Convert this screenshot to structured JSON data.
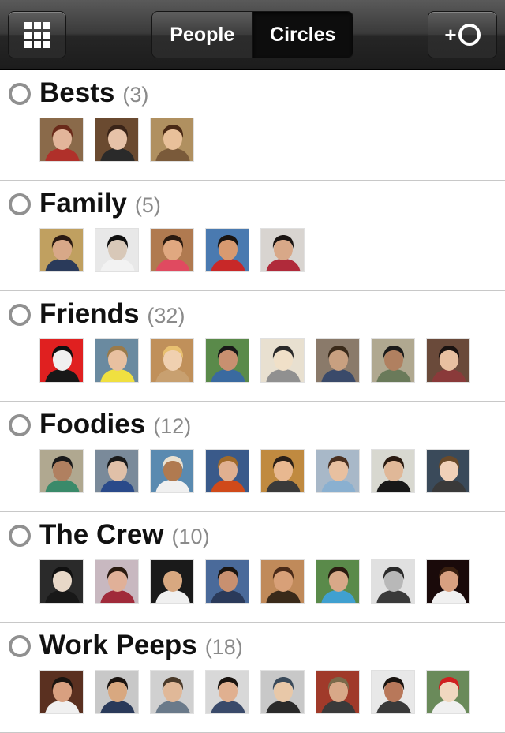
{
  "header": {
    "grid_icon": "grid-icon",
    "tabs": [
      {
        "label": "People",
        "selected": false
      },
      {
        "label": "Circles",
        "selected": true
      }
    ],
    "add_circle": {
      "plus": "+",
      "icon": "circle-ring-icon"
    }
  },
  "circles": [
    {
      "name": "Bests",
      "count": "(3)",
      "avatars": [
        {
          "bg": "#8a6a4a",
          "skin": "#e2b59a",
          "hair": "#6a2a1a",
          "shirt": "#b0302a"
        },
        {
          "bg": "#6a4a30",
          "skin": "#e6c2a8",
          "hair": "#3a2418",
          "shirt": "#2a2a2a"
        },
        {
          "bg": "#b09060",
          "skin": "#e8c09a",
          "hair": "#4a2a16",
          "shirt": "#7a5a3a"
        }
      ]
    },
    {
      "name": "Family",
      "count": "(5)",
      "avatars": [
        {
          "bg": "#c0a060",
          "skin": "#d8a888",
          "hair": "#2a1a12",
          "shirt": "#2a3a5a"
        },
        {
          "bg": "#e8e8e8",
          "skin": "#d8c8b8",
          "hair": "#101010",
          "shirt": "#f2f2f2"
        },
        {
          "bg": "#b07a50",
          "skin": "#e0a880",
          "hair": "#2a1a10",
          "shirt": "#e04a60"
        },
        {
          "bg": "#4a7ab0",
          "skin": "#d89a70",
          "hair": "#1a1410",
          "shirt": "#c82828"
        },
        {
          "bg": "#d8d4d0",
          "skin": "#d8a888",
          "hair": "#1a1412",
          "shirt": "#b02a3a"
        }
      ]
    },
    {
      "name": "Friends",
      "count": "(32)",
      "avatars": [
        {
          "bg": "#e02020",
          "skin": "#f0f0f0",
          "hair": "#101010",
          "shirt": "#181818"
        },
        {
          "bg": "#6a8aa0",
          "skin": "#e8c0a0",
          "hair": "#9a7a4a",
          "shirt": "#f0e040"
        },
        {
          "bg": "#c0905a",
          "skin": "#f0d0b0",
          "hair": "#e8c070",
          "shirt": "#c8a070"
        },
        {
          "bg": "#5a8a4a",
          "skin": "#c89070",
          "hair": "#181818",
          "shirt": "#3a6aa0"
        },
        {
          "bg": "#e8e0d0",
          "skin": "#f0e0c8",
          "hair": "#2a2a2a",
          "shirt": "#909090"
        },
        {
          "bg": "#8a7a6a",
          "skin": "#c8a080",
          "hair": "#3a2a1a",
          "shirt": "#3a4a6a"
        },
        {
          "bg": "#b0a890",
          "skin": "#b08060",
          "hair": "#1a1a1a",
          "shirt": "#6a7a5a"
        },
        {
          "bg": "#6a4a3a",
          "skin": "#e8c0a0",
          "hair": "#1a1210",
          "shirt": "#8a3a3a"
        }
      ]
    },
    {
      "name": "Foodies",
      "count": "(12)",
      "avatars": [
        {
          "bg": "#b0a890",
          "skin": "#b08060",
          "hair": "#1a1a1a",
          "shirt": "#3a8a6a"
        },
        {
          "bg": "#7a8a9a",
          "skin": "#e0c0a8",
          "hair": "#1a1a1a",
          "shirt": "#2a4a8a"
        },
        {
          "bg": "#5a8ab0",
          "skin": "#b07a50",
          "hair": "#e8e0d0",
          "shirt": "#f0f0f0"
        },
        {
          "bg": "#3a5a8a",
          "skin": "#e0b090",
          "hair": "#a06a2a",
          "shirt": "#d04a1a"
        },
        {
          "bg": "#c08a40",
          "skin": "#e8b890",
          "hair": "#2a2018",
          "shirt": "#3a3a3a"
        },
        {
          "bg": "#a8b8c8",
          "skin": "#e8c0a0",
          "hair": "#4a3020",
          "shirt": "#8ab0d0"
        },
        {
          "bg": "#d8d8d0",
          "skin": "#e0b898",
          "hair": "#2a1a10",
          "shirt": "#181818"
        },
        {
          "bg": "#3a4a5a",
          "skin": "#f0d0b8",
          "hair": "#6a4a2a",
          "shirt": "#3a3a3a"
        }
      ]
    },
    {
      "name": "The Crew",
      "count": "(10)",
      "avatars": [
        {
          "bg": "#2a2a2a",
          "skin": "#e8d8c8",
          "hair": "#101010",
          "shirt": "#181818"
        },
        {
          "bg": "#c8b8c0",
          "skin": "#e0b098",
          "hair": "#2a1a10",
          "shirt": "#a02a3a"
        },
        {
          "bg": "#1a1a1a",
          "skin": "#d8a880",
          "hair": "#1a1a1a",
          "shirt": "#f0f0f0"
        },
        {
          "bg": "#4a6a9a",
          "skin": "#c89070",
          "hair": "#1a1410",
          "shirt": "#2a3a5a"
        },
        {
          "bg": "#c08a5a",
          "skin": "#d8a078",
          "hair": "#4a2a18",
          "shirt": "#3a2a1a"
        },
        {
          "bg": "#5a8a4a",
          "skin": "#d8a888",
          "hair": "#2a1a10",
          "shirt": "#40a0d0"
        },
        {
          "bg": "#e0e0e0",
          "skin": "#b8b8b8",
          "hair": "#2a2a2a",
          "shirt": "#3a3a3a"
        },
        {
          "bg": "#1a0a0a",
          "skin": "#d8a080",
          "hair": "#3a2010",
          "shirt": "#f0f0f0"
        }
      ]
    },
    {
      "name": "Work Peeps",
      "count": "(18)",
      "avatars": [
        {
          "bg": "#5a3020",
          "skin": "#d8a080",
          "hair": "#1a1410",
          "shirt": "#f0f0f0"
        },
        {
          "bg": "#c8c8c8",
          "skin": "#d8a880",
          "hair": "#1a1410",
          "shirt": "#2a3a5a"
        },
        {
          "bg": "#d0d0d0",
          "skin": "#e0b898",
          "hair": "#4a3a2a",
          "shirt": "#6a7a8a"
        },
        {
          "bg": "#d8d8d8",
          "skin": "#e0b090",
          "hair": "#1a1410",
          "shirt": "#3a4a6a"
        },
        {
          "bg": "#c8c8c8",
          "skin": "#e8c8a8",
          "hair": "#3a4a5a",
          "shirt": "#2a2a2a"
        },
        {
          "bg": "#a03a2a",
          "skin": "#d8a888",
          "hair": "#7a6a4a",
          "shirt": "#3a3a3a"
        },
        {
          "bg": "#e8e8e8",
          "skin": "#b8785a",
          "hair": "#1a1410",
          "shirt": "#3a3a3a"
        },
        {
          "bg": "#6a8a5a",
          "skin": "#f0d8c0",
          "hair": "#d02020",
          "shirt": "#f0f0f0"
        }
      ]
    }
  ]
}
